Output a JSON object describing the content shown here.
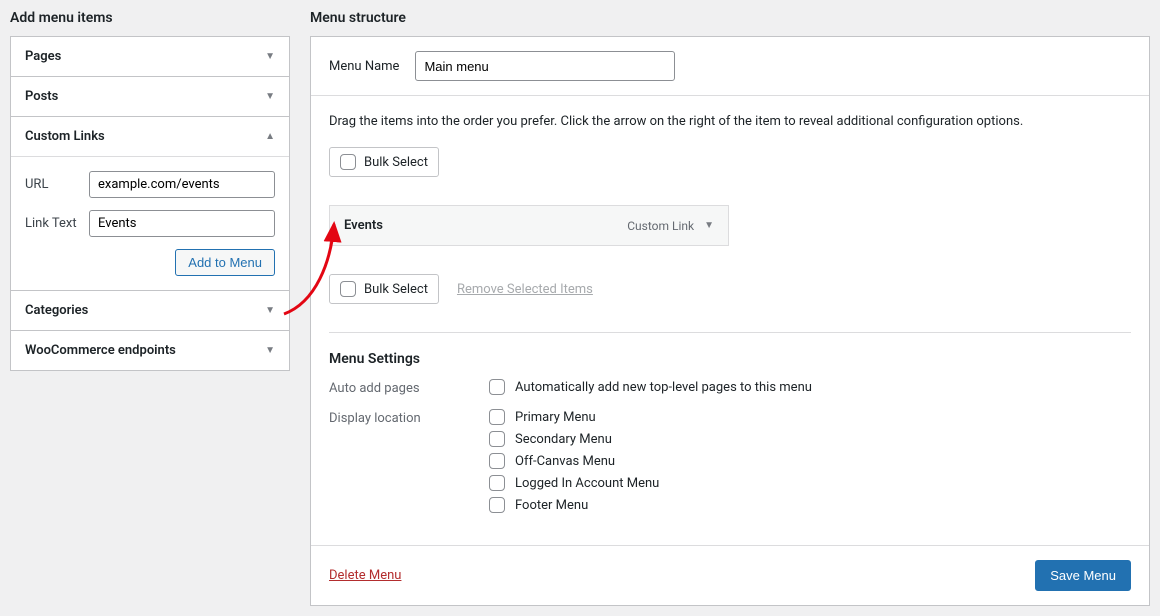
{
  "left": {
    "heading": "Add menu items",
    "sections": {
      "pages": {
        "label": "Pages"
      },
      "posts": {
        "label": "Posts"
      },
      "customLinks": {
        "label": "Custom Links",
        "urlLabel": "URL",
        "urlValue": "example.com/events",
        "linkTextLabel": "Link Text",
        "linkTextValue": "Events",
        "addButton": "Add to Menu"
      },
      "categories": {
        "label": "Categories"
      },
      "woocommerce": {
        "label": "WooCommerce endpoints"
      }
    }
  },
  "right": {
    "heading": "Menu structure",
    "menuNameLabel": "Menu Name",
    "menuNameValue": "Main menu",
    "instructions": "Drag the items into the order you prefer. Click the arrow on the right of the item to reveal additional configuration options.",
    "bulkSelect": "Bulk Select",
    "item": {
      "title": "Events",
      "type": "Custom Link"
    },
    "removeSelected": "Remove Selected Items",
    "settings": {
      "heading": "Menu Settings",
      "autoAddLabel": "Auto add pages",
      "autoAddOption": "Automatically add new top-level pages to this menu",
      "displayLocationLabel": "Display location",
      "locations": [
        "Primary Menu",
        "Secondary Menu",
        "Off-Canvas Menu",
        "Logged In Account Menu",
        "Footer Menu"
      ]
    },
    "deleteMenu": "Delete Menu",
    "saveMenu": "Save Menu"
  }
}
